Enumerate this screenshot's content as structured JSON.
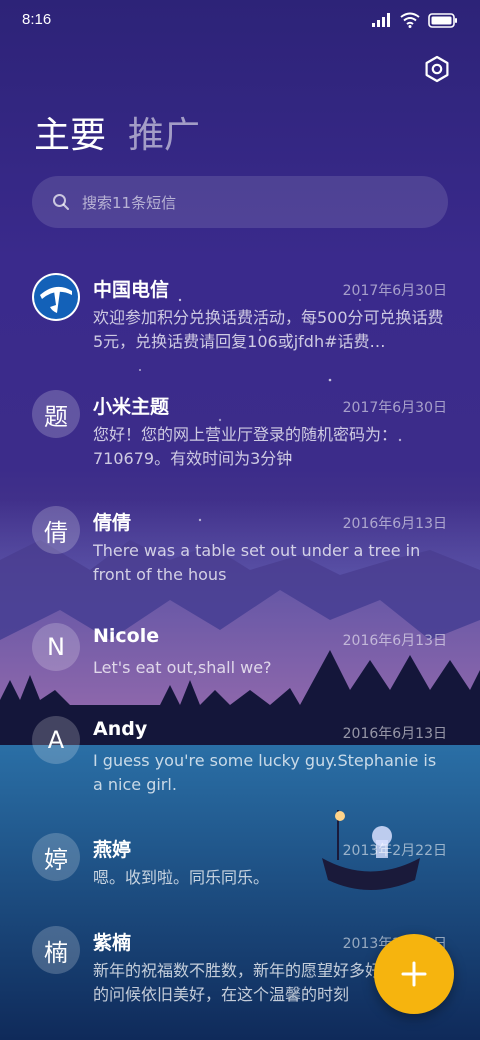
{
  "status_bar": {
    "time": "8:16",
    "icons": [
      "signal-icon",
      "wifi-icon",
      "battery-icon"
    ]
  },
  "header": {
    "settings_icon": "settings-icon",
    "tabs": [
      {
        "label": "主要",
        "active": true
      },
      {
        "label": "推广",
        "active": false
      }
    ]
  },
  "search": {
    "placeholder": "搜索11条短信",
    "icon": "search-icon"
  },
  "conversations": [
    {
      "avatar": "",
      "avatar_icon": "china-telecom-logo",
      "name": "中国电信",
      "date": "2017年6月30日",
      "preview": "欢迎参加积分兑换话费活动，每500分可兑换话费5元，兑换话费请回复106或jfdh#话费…"
    },
    {
      "avatar": "题",
      "name": "小米主题",
      "date": "2017年6月30日",
      "preview": "您好！您的网上营业厅登录的随机密码为：710679。有效时间为3分钟"
    },
    {
      "avatar": "倩",
      "name": "倩倩",
      "date": "2016年6月13日",
      "preview": "There was a table set out under a tree in front of the hous"
    },
    {
      "avatar": "N",
      "name": "Nicole",
      "date": "2016年6月13日",
      "preview": "Let's eat out,shall we?"
    },
    {
      "avatar": "A",
      "name": "Andy",
      "date": "2016年6月13日",
      "preview": "I guess you're some lucky guy.Stephanie is a nice girl."
    },
    {
      "avatar": "婷",
      "name": "燕婷",
      "date": "2013年2月22日",
      "preview": "嗯。收到啦。同乐同乐。"
    },
    {
      "avatar": "楠",
      "name": "紫楠",
      "date": "2013年2月22日",
      "preview": "新年的祝福数不胜数，新年的愿望好多好多，新年的问候依旧美好，在这个温馨的时刻"
    }
  ],
  "fab": {
    "icon": "plus-icon"
  },
  "colors": {
    "fab": "#f6b40e",
    "background": "#2d2378"
  }
}
